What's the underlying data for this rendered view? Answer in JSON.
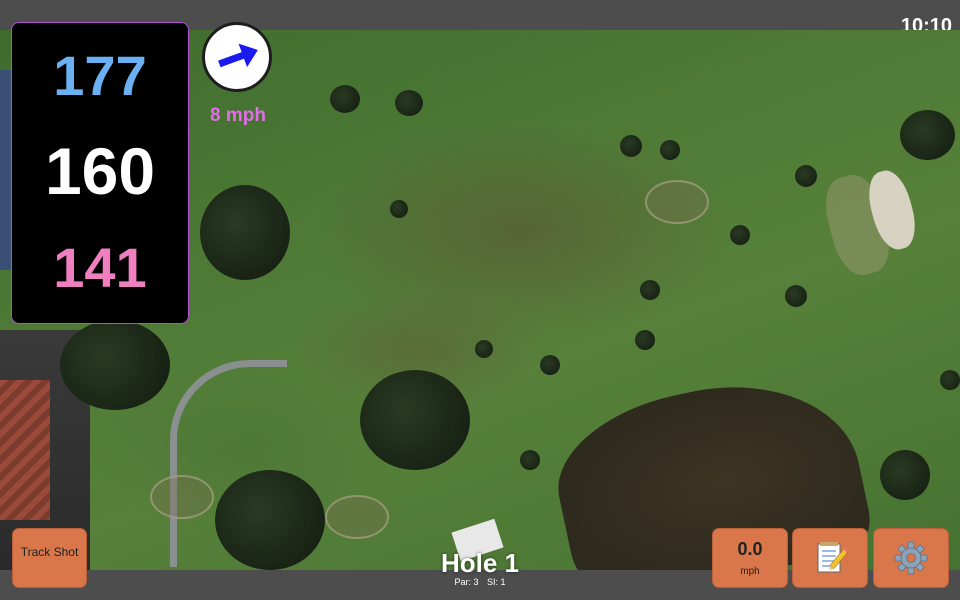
{
  "status": {
    "time": "10:10"
  },
  "distances": {
    "front": "177",
    "middle": "160",
    "back": "141"
  },
  "wind": {
    "speed": "8 mph",
    "icon": "arrow-icon"
  },
  "hole": {
    "title": "Hole 1",
    "par": "Par: 3",
    "si": "SI: 1"
  },
  "buttons": {
    "track_shot": "Track Shot",
    "speed_value": "0.0",
    "speed_unit": "mph",
    "notes_icon": "notepad-icon",
    "settings_icon": "gear-icon"
  },
  "colors": {
    "front": "#6ab0f2",
    "middle": "#ffffff",
    "back": "#f07fc0",
    "wind": "#e36ce8",
    "button": "#d9774a",
    "panel_border": "#b44fd2"
  }
}
